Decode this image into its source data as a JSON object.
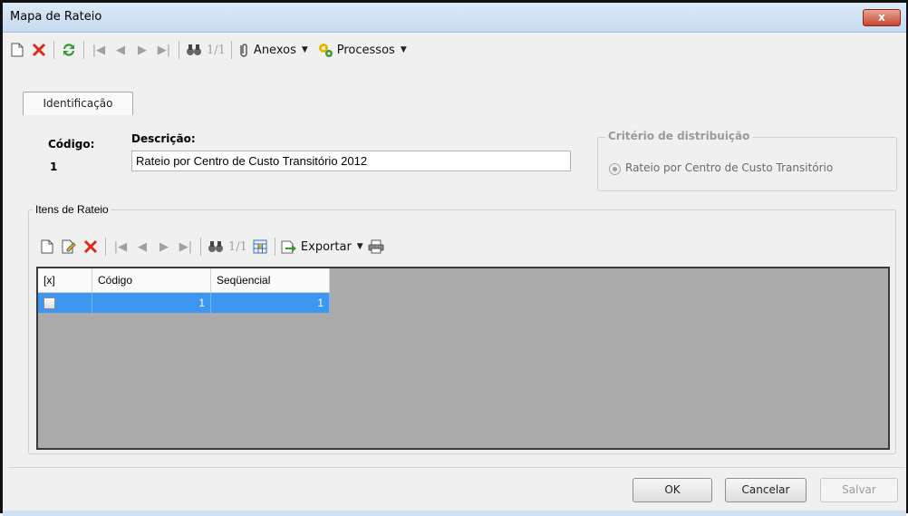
{
  "window": {
    "title": "Mapa de Rateio",
    "close_label": "x"
  },
  "toolbar": {
    "nav_count": "1/1",
    "anexos_label": "Anexos",
    "processos_label": "Processos"
  },
  "tabs": [
    {
      "label": "Identificação"
    }
  ],
  "form": {
    "codigo_label": "Código:",
    "codigo_value": "1",
    "descricao_label": "Descrição:",
    "descricao_value": "Rateio por Centro de Custo Transitório 2012",
    "criterio_label": "Critério de distribuição",
    "criterio_option": "Rateio por Centro de Custo Transitório"
  },
  "itens": {
    "legend": "Itens de Rateio",
    "nav_count": "1/1",
    "exportar_label": "Exportar",
    "columns": [
      "[x]",
      "Código",
      "Seqüencial"
    ],
    "rows": [
      {
        "codigo": "1",
        "sequencial": "1"
      }
    ]
  },
  "buttons": {
    "ok": "OK",
    "cancelar": "Cancelar",
    "salvar": "Salvar"
  },
  "colors": {
    "selection": "#3d97f0",
    "grid_background": "#ababab",
    "title_bar": "#c6daf1"
  }
}
